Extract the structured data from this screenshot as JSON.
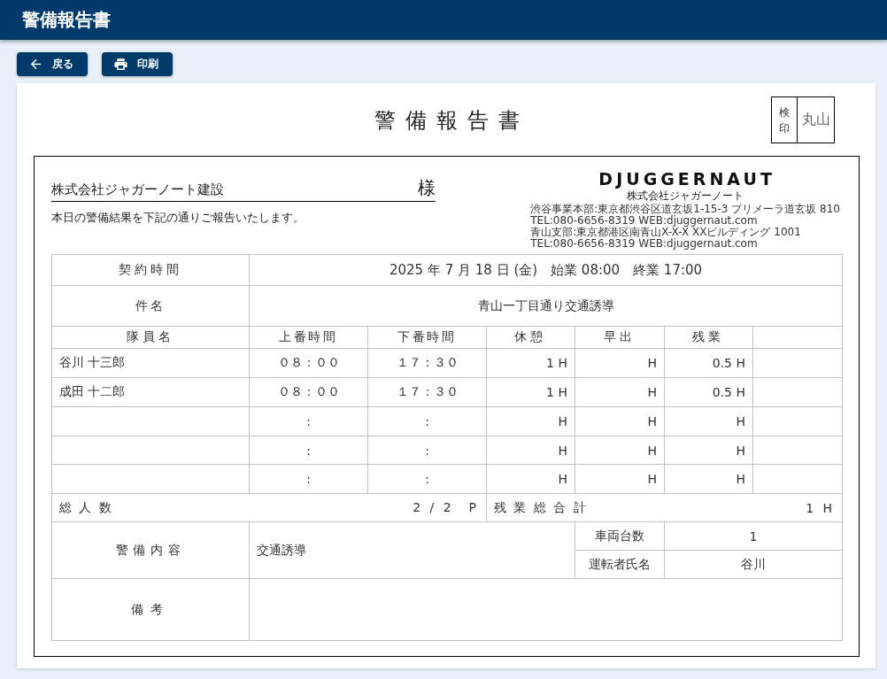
{
  "header": {
    "title": "警備報告書"
  },
  "toolbar": {
    "buttons": [
      {
        "kind": "back",
        "label": "戻る"
      },
      {
        "kind": "print",
        "label": "印刷"
      }
    ]
  },
  "report": {
    "title": "警備報告書",
    "approval_stamp": {
      "label": "検印",
      "signature": "丸山"
    },
    "recipient": {
      "name": "株式会社ジャガーノート建設",
      "honorific": "様"
    },
    "message": "本日の警備結果を下記の通りご報告いたします。",
    "company": {
      "logo": "DJUGGERNAUT",
      "name": "株式会社ジャガーノート",
      "address_lines": [
        "渋谷事業本部:東京都渋谷区道玄坂1-15-3 プリメーラ道玄坂 810",
        "TEL:080-6656-8319 WEB:djuggernaut.com",
        "青山支部:東京都港区南青山X-X-X XXビルディング 1001",
        "TEL:080-6656-8319 WEB:djuggernaut.com"
      ]
    },
    "contract_time": {
      "label": "契約時間",
      "value": "2025 年 7 月 18 日 (金)　始業 08:00　終業 17:00"
    },
    "subject": {
      "label": "件名",
      "value": "青山一丁目通り交通誘導"
    },
    "staff_table": {
      "columns": [
        "隊員名",
        "上番時間",
        "下番時間",
        "休憩",
        "早出",
        "残業"
      ],
      "rows": [
        {
          "name": "谷川 十三郎",
          "start": "０８：００",
          "end": "１７：３０",
          "break": "1 H",
          "early": "H",
          "overtime": "0.5 H"
        },
        {
          "name": "成田 十二郎",
          "start": "０８：００",
          "end": "１７：３０",
          "break": "1 H",
          "early": "H",
          "overtime": "0.5 H"
        },
        {
          "start": ":",
          "end": ":",
          "break": "H",
          "early": "H",
          "overtime": "H"
        },
        {
          "start": ":",
          "end": ":",
          "break": "H",
          "early": "H",
          "overtime": "H"
        },
        {
          "start": ":",
          "end": ":",
          "break": "H",
          "early": "H",
          "overtime": "H"
        }
      ]
    },
    "totals": {
      "headcount_label": "総人数",
      "headcount": "2 / 2　P",
      "overtime_total_label": "残業総合計",
      "overtime_total": "1 H"
    },
    "duty": {
      "label": "警備内容",
      "value": "交通誘導",
      "vehicles_label": "車両台数",
      "vehicles": "1",
      "driver_label": "運転者氏名",
      "driver": "谷川"
    },
    "remarks": {
      "label": "備考"
    }
  }
}
